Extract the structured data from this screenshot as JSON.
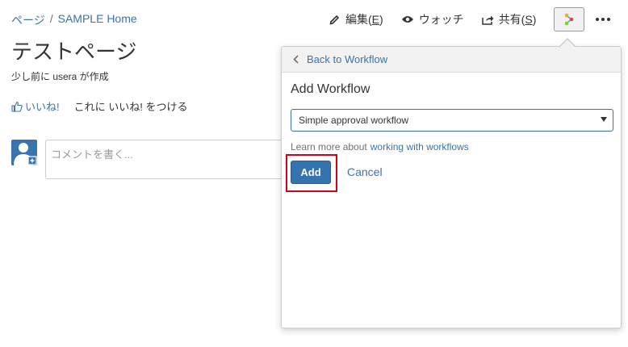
{
  "breadcrumb": {
    "items": [
      "ページ",
      "SAMPLE Home"
    ],
    "separator": "/"
  },
  "toolbar": {
    "edit": {
      "label": "編集(",
      "key": "E",
      "suffix": ")",
      "icon": "pencil-icon"
    },
    "watch": {
      "label": "ウォッチ",
      "icon": "eye-icon"
    },
    "share": {
      "label": "共有(",
      "key": "S",
      "suffix": ")",
      "icon": "share-icon"
    },
    "workflow_icon": "workflow-icon",
    "more_icon": "more-dots-icon"
  },
  "page": {
    "title": "テストページ",
    "byline": "少し前に usera が作成",
    "like_label": "いいね!",
    "like_prompt": "これに いいね! をつける",
    "comment_placeholder": "コメントを書く..."
  },
  "workflow_popup": {
    "back_label": "Back to Workflow",
    "title": "Add Workflow",
    "selected_workflow": "Simple approval workflow",
    "learn_prefix": "Learn more about",
    "learn_link": "working with workflows",
    "add_label": "Add",
    "cancel_label": "Cancel"
  },
  "colors": {
    "link": "#3b73af",
    "primary_button": "#3572b0",
    "highlight": "#d0021b"
  }
}
